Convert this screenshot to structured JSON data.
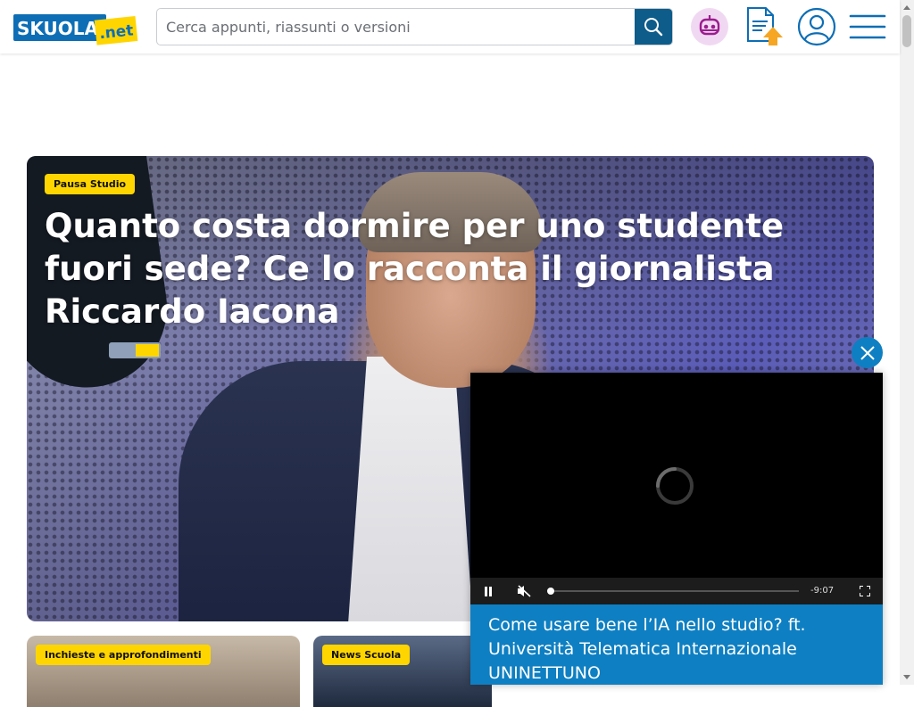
{
  "header": {
    "logo": {
      "brand": "SKUOLA",
      "tld": ".net"
    },
    "search": {
      "placeholder": "Cerca appunti, riassunti o versioni"
    },
    "icons": [
      "search-icon",
      "robot-icon",
      "document-upload-icon",
      "user-icon",
      "menu-icon"
    ],
    "accent_color": "#0d5c8a"
  },
  "hero": {
    "category": "Pausa Studio",
    "title": "Quanto costa dormire per uno studente fuori sede? Ce lo racconta il giornalista Riccardo Iacona",
    "badge_color": "#ffd500"
  },
  "cards": [
    {
      "category": "Inchieste e approfondimenti"
    },
    {
      "category": "News Scuola"
    }
  ],
  "video_player": {
    "time_remaining": "-9:07",
    "progress": 0,
    "playing": true,
    "muted": true,
    "title": "Come usare bene l’IA nello studio? ft. Università Telematica Internazionale UNINETTUNO",
    "caption_color": "#0e7fc2"
  }
}
